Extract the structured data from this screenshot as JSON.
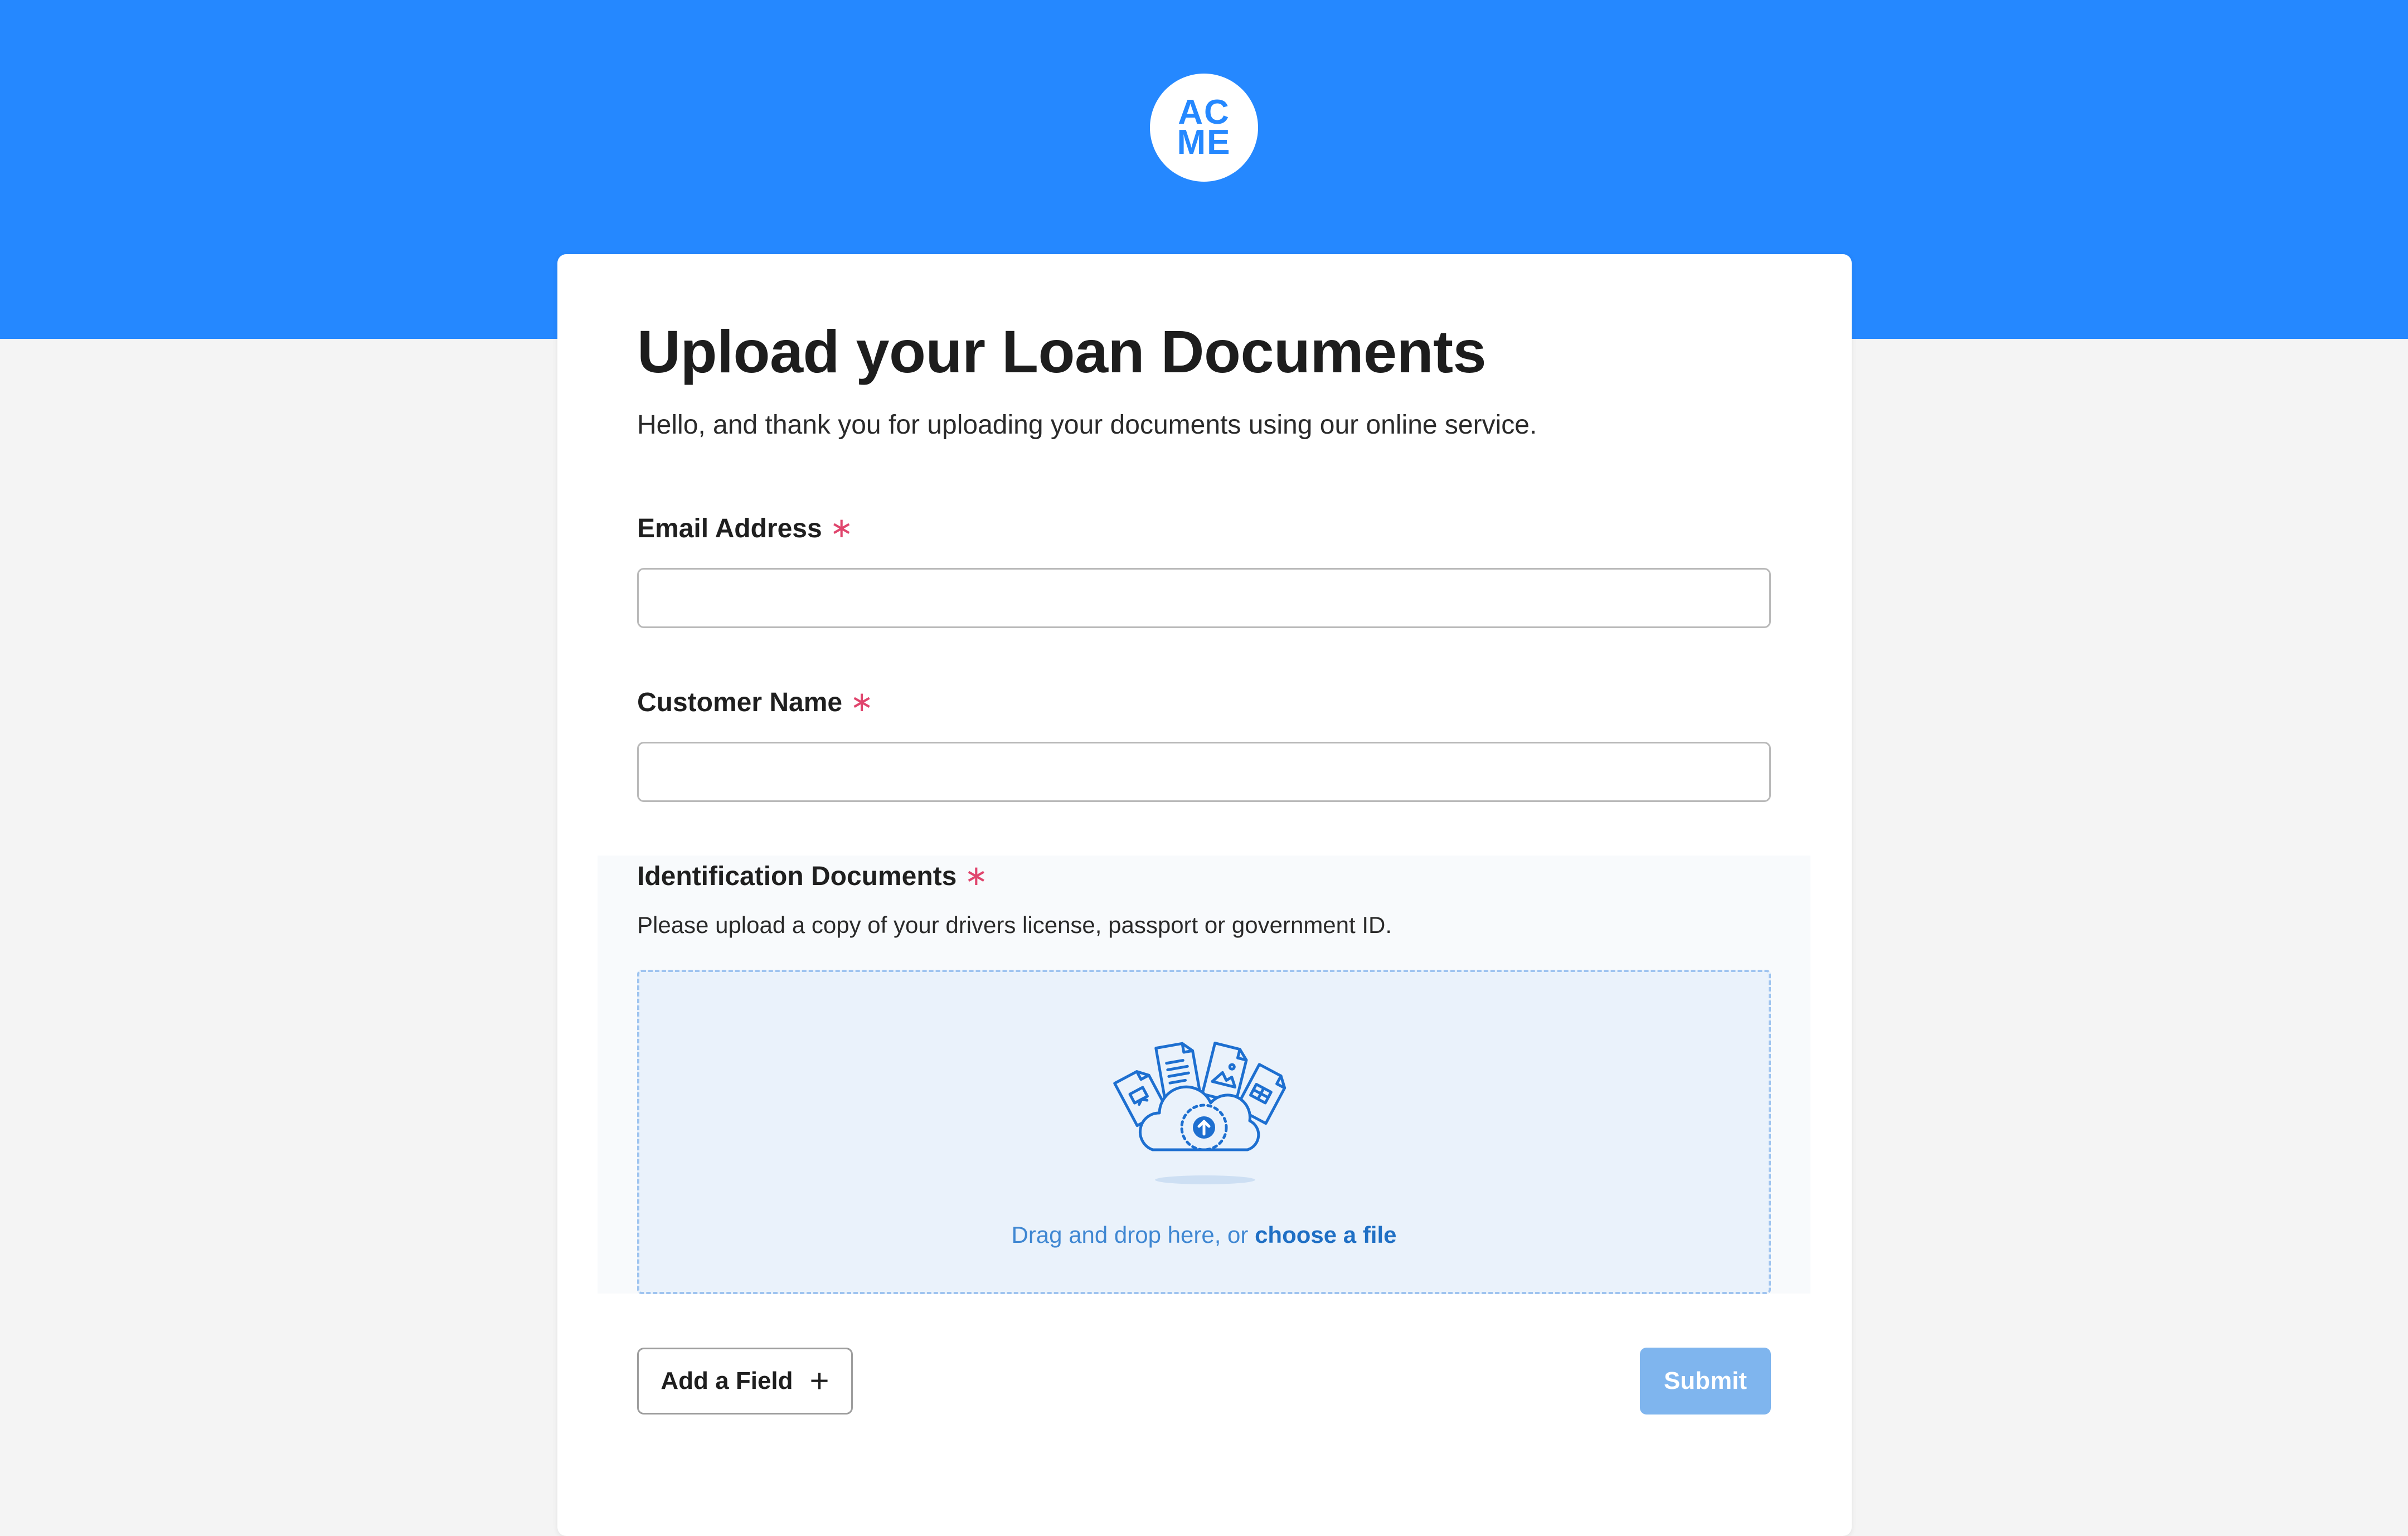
{
  "brand": {
    "logo_line1": "AC",
    "logo_line2": "ME",
    "header_color": "#2588ff"
  },
  "form": {
    "title": "Upload your Loan Documents",
    "intro": "Hello, and thank you for uploading your documents using our online service.",
    "required_marker": "∗",
    "fields": [
      {
        "label": "Email Address",
        "value": "",
        "required": true
      },
      {
        "label": "Customer Name",
        "value": "",
        "required": true
      }
    ],
    "upload": {
      "label": "Identification Documents",
      "required": true,
      "help": "Please upload a copy of your drivers license, passport or government ID.",
      "drop_text": "Drag and drop here, or ",
      "choose_link": "choose a file",
      "icon": "cloud-upload-icon"
    },
    "buttons": {
      "add_field_label": "Add a Field",
      "add_field_icon": "+",
      "submit_label": "Submit"
    }
  }
}
